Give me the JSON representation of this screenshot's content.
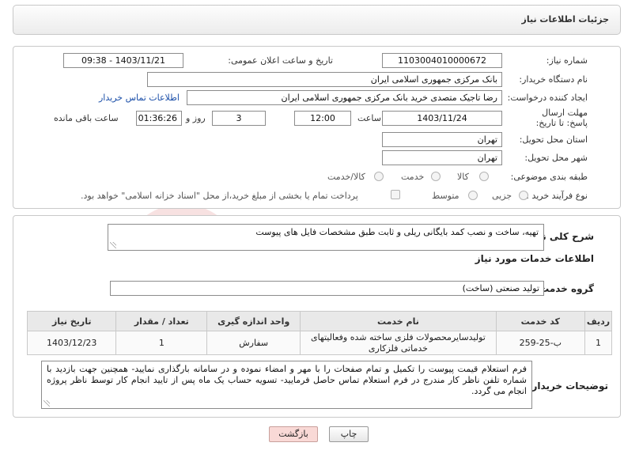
{
  "header": {
    "title": "جزئیات اطلاعات نیاز"
  },
  "fields": {
    "need_number_label": "شماره نیاز:",
    "need_number": "1103004010000672",
    "announce_label": "تاریخ و ساعت اعلان عمومی:",
    "announce_value": "1403/11/21 - 09:38",
    "buyer_org_label": "نام دستگاه خریدار:",
    "buyer_org": "بانک مرکزی جمهوری اسلامی ایران",
    "requester_label": "ایجاد کننده درخواست:",
    "requester": "رضا تاجیک متصدی خرید بانک مرکزی جمهوری اسلامی ایران",
    "contact_link": "اطلاعات تماس خریدار",
    "deadline_label": "مهلت ارسال پاسخ: تا تاریخ:",
    "deadline_date": "1403/11/24",
    "time_label": "ساعت",
    "deadline_time": "12:00",
    "days_value": "3",
    "days_label": "روز و",
    "remaining_time": "01:36:26",
    "remaining_label": "ساعت باقی مانده",
    "province_label": "استان محل تحویل:",
    "province": "تهران",
    "city_label": "شهر محل تحویل:",
    "city": "تهران",
    "category_label": "طبقه بندی موضوعی:",
    "category_options": [
      "کالا",
      "خدمت",
      "کالا/خدمت"
    ],
    "process_label": "نوع فرآیند خرید :",
    "process_options": [
      "جزیی",
      "متوسط"
    ],
    "payment_note": "پرداخت تمام یا بخشی از مبلغ خرید،از محل \"اسناد خزانه اسلامی\" خواهد بود."
  },
  "description": {
    "label": "شرح کلی نیاز:",
    "text": "تهیه، ساخت و نصب کمد بایگانی ریلی و ثابت طبق مشخصات فایل های پیوست"
  },
  "services": {
    "title": "اطلاعات خدمات مورد نیاز",
    "group_label": "گروه خدمت:",
    "group_value": "تولید صنعتی (ساخت)",
    "columns": [
      "ردیف",
      "کد خدمت",
      "نام خدمت",
      "واحد اندازه گیری",
      "تعداد / مقدار",
      "تاریخ نیاز"
    ],
    "rows": [
      [
        "1",
        "ب-25-259",
        "تولیدسایرمحصولات فلزی ساخته شده وفعالیتهای خدماتی فلزکاری",
        "سفارش",
        "1",
        "1403/12/23"
      ]
    ]
  },
  "buyer_notes": {
    "label": "توضیحات خریدار:",
    "text": "فرم استعلام قیمت پیوست را تکمیل و تمام صفحات را با مهر و امضاء نموده و در سامانه بارگذاری نمایید- همچنین جهت بازدید با شماره تلفن ناظر کار مندرج در فرم استعلام تماس حاصل فرمایید- تسویه حساب یک ماه پس از تایید انجام کار توسط ناظر پروژه انجام می گردد."
  },
  "buttons": {
    "print": "چاپ",
    "back": "بازگشت"
  },
  "watermark": {
    "text": "AriaTender.neT"
  },
  "colors": {
    "link": "#1a4ea8",
    "back_button": "#f9d9d6",
    "watermark": "#f1c9c9"
  }
}
